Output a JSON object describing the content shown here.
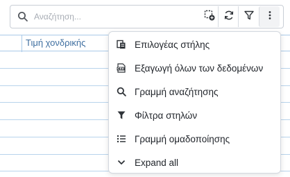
{
  "search": {
    "placeholder": "Αναζήτηση..."
  },
  "toolbar": {
    "icons": [
      "add-filter-icon",
      "refresh-icon",
      "filter-icon",
      "more-vertical-icon"
    ]
  },
  "grid": {
    "columns": [
      "",
      "Τιμή χονδρικής"
    ]
  },
  "menu": {
    "items": [
      {
        "label": "Επιλογέας στήλης",
        "icon": "column-chooser-icon"
      },
      {
        "label": "Εξαγωγή όλων των δεδομένων",
        "icon": "csv-export-icon"
      },
      {
        "label": "Γραμμή αναζήτησης",
        "icon": "search-icon"
      },
      {
        "label": "Φίλτρα στηλών",
        "icon": "filter-funnel-icon"
      },
      {
        "label": "Γραμμή ομαδοποίησης",
        "icon": "list-icon"
      },
      {
        "label": "Expand all",
        "icon": "chevron-down-icon"
      }
    ]
  },
  "colors": {
    "grid_line": "#a9c9e8",
    "header_text": "#3f6fa0",
    "border": "#c9ced6"
  }
}
